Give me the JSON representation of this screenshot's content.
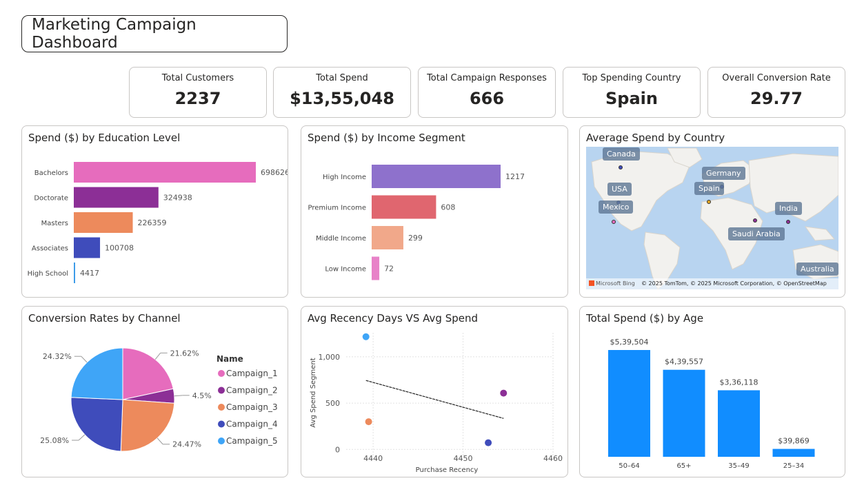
{
  "dashboard_title": "Marketing Campaign Dashboard",
  "kpis": [
    {
      "label": "Total Customers",
      "value": "2237"
    },
    {
      "label": "Total Spend",
      "value": "$13,55,048"
    },
    {
      "label": "Total Campaign Responses",
      "value": "666"
    },
    {
      "label": "Top Spending Country",
      "value": "Spain"
    },
    {
      "label": "Overall Conversion Rate",
      "value": "29.77"
    }
  ],
  "panels": {
    "education": "Spend ($) by Education Level",
    "income": "Spend ($) by Income Segment",
    "map": "Average Spend by Country",
    "channel": "Conversion Rates by Channel",
    "recency": "Avg Recency Days VS Avg Spend",
    "age": "Total Spend ($) by Age"
  },
  "map": {
    "countries": [
      "Canada",
      "Germany",
      "USA",
      "Spain",
      "Mexico",
      "India",
      "Saudi Arabia",
      "Australia"
    ],
    "attribution_brand": "Microsoft Bing",
    "attribution_text": "© 2025 TomTom, © 2025 Microsoft Corporation, © OpenStreetMap",
    "ocean_color": "#b8d4f0",
    "land_color": "#f2f1ee"
  },
  "chart_data": [
    {
      "id": "education",
      "type": "bar",
      "orientation": "horizontal",
      "categories": [
        "Bachelors",
        "Doctorate",
        "Masters",
        "Associates",
        "High School"
      ],
      "values": [
        698626,
        324938,
        226359,
        100708,
        4417
      ],
      "data_labels": [
        "698626",
        "324938",
        "226359",
        "100708",
        "4417"
      ],
      "colors": [
        "#e66cbd",
        "#8c2f96",
        "#ed8a5c",
        "#3f4cbb",
        "#3c9be8"
      ]
    },
    {
      "id": "income",
      "type": "bar",
      "orientation": "horizontal",
      "categories": [
        "High Income",
        "Premium Income",
        "Middle Income",
        "Low Income"
      ],
      "values": [
        1217,
        608,
        299,
        72
      ],
      "data_labels": [
        "1217",
        "608",
        "299",
        "72"
      ],
      "colors": [
        "#8e71cc",
        "#e0666f",
        "#f1a88a",
        "#e882c8"
      ]
    },
    {
      "id": "channel",
      "type": "pie",
      "legend_title": "Name",
      "legend_position": "right",
      "slices": [
        {
          "name": "Campaign_1",
          "value": 21.62,
          "label": "21.62%",
          "color": "#e66cbd"
        },
        {
          "name": "Campaign_2",
          "value": 4.5,
          "label": "4.5%",
          "color": "#8c2f96"
        },
        {
          "name": "Campaign_3",
          "value": 24.47,
          "label": "24.47%",
          "color": "#ed8a5c"
        },
        {
          "name": "Campaign_4",
          "value": 25.08,
          "label": "25.08%",
          "color": "#3f4cbb"
        },
        {
          "name": "Campaign_5",
          "value": 24.32,
          "label": "24.32%",
          "color": "#3fa5f7"
        }
      ]
    },
    {
      "id": "recency",
      "type": "scatter",
      "xlabel": "Purchase Recency",
      "ylabel": "Avg Spend Segment",
      "xlim": [
        4437,
        4460
      ],
      "ylim": [
        -80,
        1260
      ],
      "xticks": [
        4440,
        4450,
        4460
      ],
      "xtick_labels": [
        "4440",
        "4450",
        "4460"
      ],
      "yticks": [
        0,
        500,
        1000
      ],
      "ytick_labels": [
        "0",
        "500",
        "1,000"
      ],
      "grid": true,
      "points": [
        {
          "x": 4439.2,
          "y": 1217,
          "color": "#3fa5f7"
        },
        {
          "x": 4439.5,
          "y": 299,
          "color": "#ed8a5c"
        },
        {
          "x": 4454.5,
          "y": 608,
          "color": "#8c2f96"
        },
        {
          "x": 4452.8,
          "y": 72,
          "color": "#3f4cbb"
        }
      ],
      "trendline": {
        "x": [
          4439.2,
          4454.5
        ],
        "y": [
          745,
          335
        ]
      }
    },
    {
      "id": "age",
      "type": "bar",
      "orientation": "vertical",
      "categories": [
        "50–64",
        "65+",
        "35–49",
        "25–34"
      ],
      "values": [
        539504,
        439557,
        336118,
        39869
      ],
      "data_labels": [
        "$5,39,504",
        "$4,39,557",
        "$3,36,118",
        "$39,869"
      ],
      "color": "#118dff"
    }
  ]
}
